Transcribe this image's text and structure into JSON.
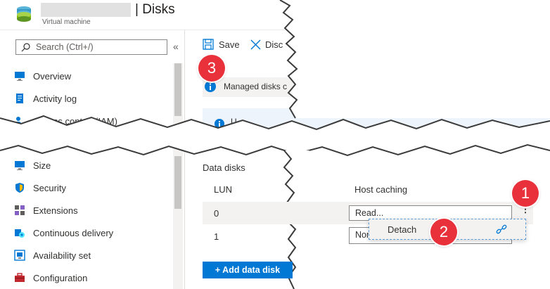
{
  "header": {
    "title": "| Disks",
    "subtitle": "Virtual machine"
  },
  "search": {
    "placeholder": "Search (Ctrl+/)"
  },
  "sidebar": {
    "collapse_glyph": "«",
    "items_top": [
      {
        "label": "Overview",
        "icon": "overview-icon"
      },
      {
        "label": "Activity log",
        "icon": "activity-log-icon"
      },
      {
        "label": "Access control (IAM)",
        "icon": "iam-icon"
      }
    ],
    "items_bottom": [
      {
        "label": "Size",
        "icon": "size-icon"
      },
      {
        "label": "Security",
        "icon": "security-shield-icon"
      },
      {
        "label": "Extensions",
        "icon": "extensions-icon"
      },
      {
        "label": "Continuous delivery",
        "icon": "continuous-delivery-icon"
      },
      {
        "label": "Availability set",
        "icon": "availability-set-icon"
      },
      {
        "label": "Configuration",
        "icon": "configuration-icon"
      }
    ]
  },
  "toolbar": {
    "save_label": "Save",
    "discard_label": "Disc"
  },
  "banner": {
    "text": "Managed disks c"
  },
  "banner2": {
    "text": "U"
  },
  "data_disks": {
    "section_title": "Data disks",
    "columns": {
      "lun": "LUN",
      "host_caching": "Host caching"
    },
    "rows": [
      {
        "lun": "0",
        "host_caching": "Read..."
      },
      {
        "lun": "1",
        "host_caching": "Non..."
      }
    ],
    "more_glyph": "⋮",
    "add_button": "+ Add data disk"
  },
  "context_menu": {
    "detach_label": "Detach"
  },
  "callouts": [
    "1",
    "2",
    "3"
  ],
  "colors": {
    "accent": "#0078d4",
    "callout": "#e8313a"
  }
}
